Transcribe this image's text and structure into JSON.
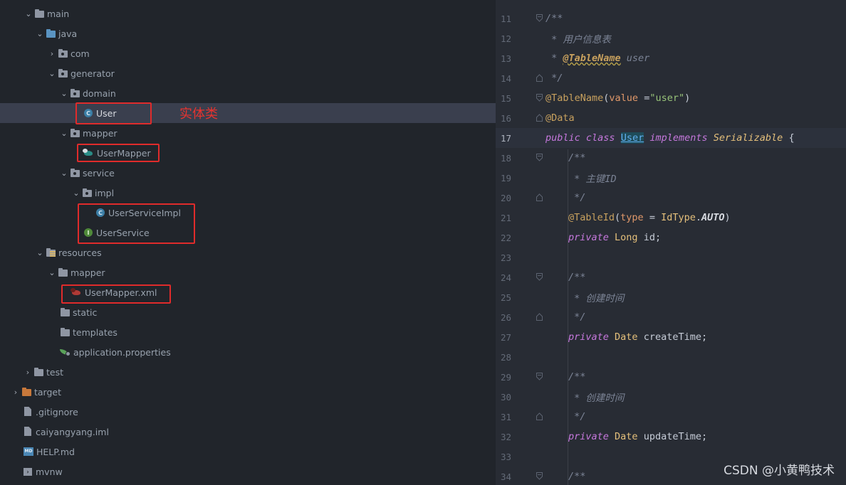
{
  "tree": {
    "items": [
      {
        "label": "main",
        "expanded": "open",
        "icon": "folder-icon"
      },
      {
        "label": "java",
        "expanded": "open",
        "icon": "source-folder-icon"
      },
      {
        "label": "com",
        "expanded": "closed",
        "icon": "package-icon"
      },
      {
        "label": "generator",
        "expanded": "open",
        "icon": "package-icon"
      },
      {
        "label": "domain",
        "expanded": "open",
        "icon": "package-icon"
      },
      {
        "label": "User",
        "icon": "class-icon",
        "selected": true
      },
      {
        "label": "mapper",
        "expanded": "open",
        "icon": "package-icon"
      },
      {
        "label": "UserMapper",
        "icon": "mybatis-mapper-icon"
      },
      {
        "label": "service",
        "expanded": "open",
        "icon": "package-icon"
      },
      {
        "label": "impl",
        "expanded": "open",
        "icon": "package-icon"
      },
      {
        "label": "UserServiceImpl",
        "icon": "class-icon"
      },
      {
        "label": "UserService",
        "icon": "interface-icon"
      },
      {
        "label": "resources",
        "expanded": "open",
        "icon": "resources-folder-icon"
      },
      {
        "label": "mapper",
        "expanded": "open",
        "icon": "folder-icon"
      },
      {
        "label": "UserMapper.xml",
        "icon": "mybatis-xml-icon"
      },
      {
        "label": "static",
        "icon": "folder-icon"
      },
      {
        "label": "templates",
        "icon": "folder-icon"
      },
      {
        "label": "application.properties",
        "icon": "spring-properties-icon"
      },
      {
        "label": "test",
        "expanded": "closed",
        "icon": "folder-icon"
      },
      {
        "label": "target",
        "expanded": "closed",
        "icon": "excluded-folder-icon"
      },
      {
        "label": ".gitignore",
        "icon": "gitignore-file-icon"
      },
      {
        "label": "caiyangyang.iml",
        "icon": "iml-file-icon"
      },
      {
        "label": "HELP.md",
        "icon": "markdown-file-icon"
      },
      {
        "label": "mvnw",
        "icon": "terminal-file-icon"
      }
    ],
    "annotation": "实体类",
    "highlight_color": "#e02b2b"
  },
  "editor": {
    "line_numbers": [
      "11",
      "12",
      "13",
      "14",
      "15",
      "16",
      "17",
      "18",
      "19",
      "20",
      "21",
      "22",
      "23",
      "24",
      "25",
      "26",
      "27",
      "28",
      "29",
      "30",
      "31",
      "32",
      "33",
      "34"
    ],
    "current_line": "17",
    "code": {
      "l11": "/**",
      "l12_prefix": " * ",
      "l12_text": "用户信息表",
      "l13_prefix": " * ",
      "l13_tag": "@TableName",
      "l13_value": " user",
      "l14": " */",
      "l15_ann": "@TableName",
      "l15_open": "(",
      "l15_param": "value",
      "l15_eq": " =",
      "l15_str": "\"user\"",
      "l15_close": ")",
      "l16": "@Data",
      "l17_kw1": "public",
      "l17_kw2": "class",
      "l17_name": "User",
      "l17_kw3": "implements",
      "l17_iface": "Serializable",
      "l17_brace": " {",
      "l18": "/**",
      "l19_prefix": " * ",
      "l19_text": "主键ID",
      "l20": " */",
      "l21_ann": "@TableId",
      "l21_open": "(",
      "l21_param": "type",
      "l21_eq": " = ",
      "l21_type": "IdType",
      "l21_dot": ".",
      "l21_const": "AUTO",
      "l21_close": ")",
      "l22_kw": "private",
      "l22_type": "Long",
      "l22_name": " id;",
      "l24": "/**",
      "l25_prefix": " * ",
      "l25_text": "创建时间",
      "l26": " */",
      "l27_kw": "private",
      "l27_type": "Date",
      "l27_name": " createTime;",
      "l29": "/**",
      "l30_prefix": " * ",
      "l30_text": "创建时间",
      "l31": " */",
      "l32_kw": "private",
      "l32_type": "Date",
      "l32_name": " updateTime;",
      "l34": "/**"
    }
  },
  "watermark": "CSDN @小黄鸭技术"
}
